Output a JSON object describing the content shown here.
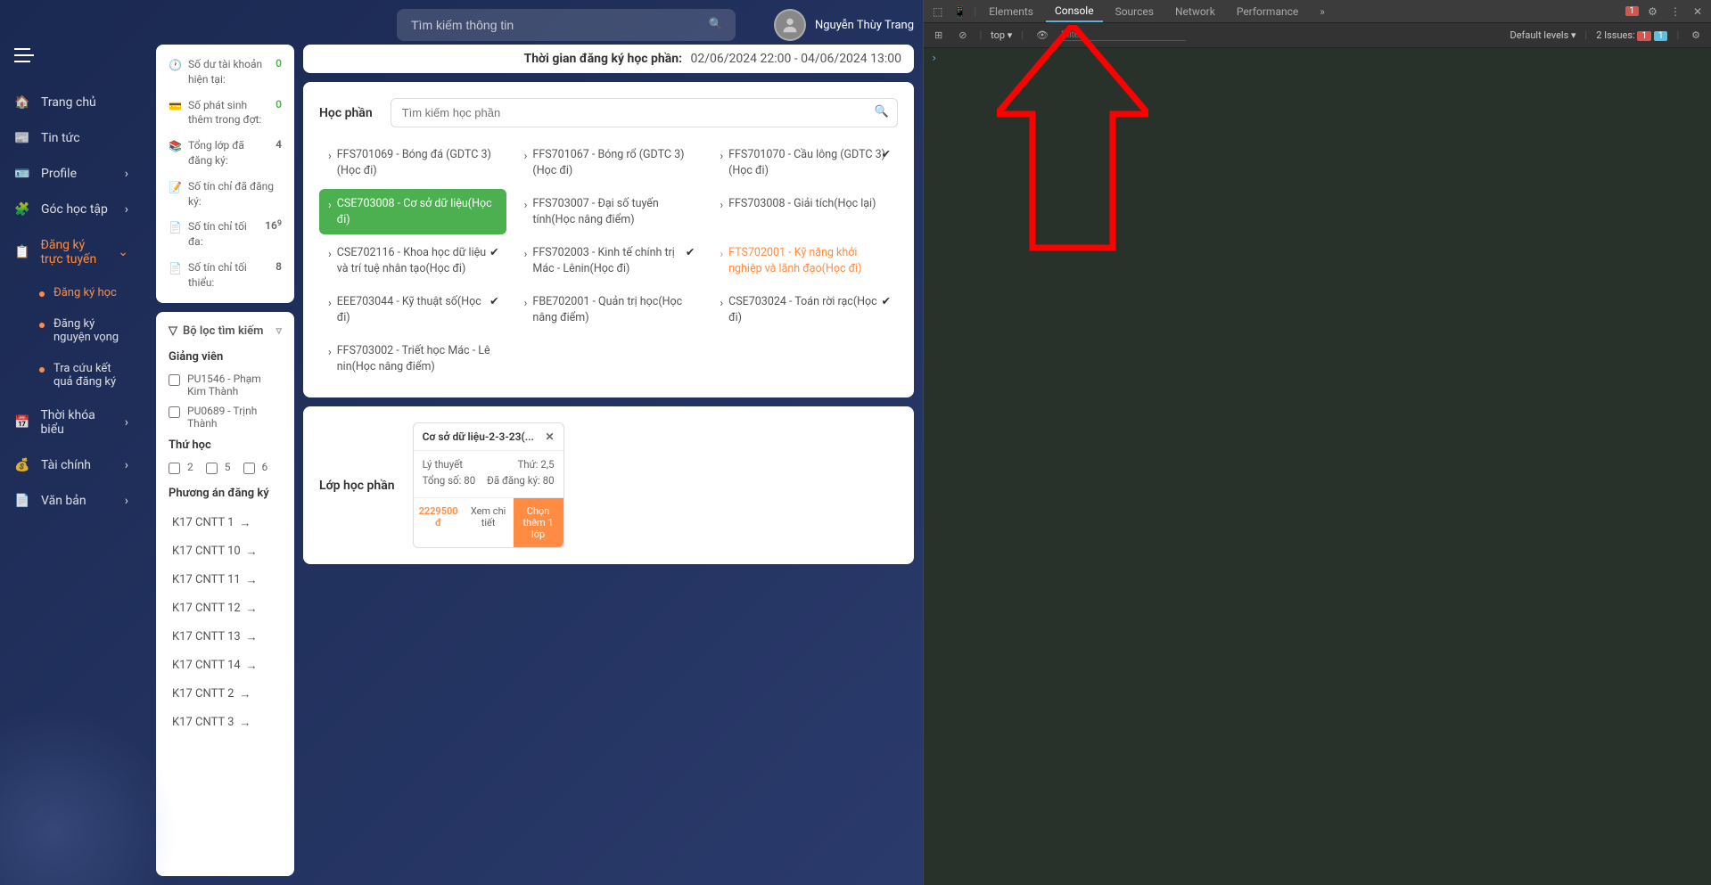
{
  "global_search_placeholder": "Tìm kiếm thông tin",
  "user_name": "Nguyễn Thùy Trang",
  "nav": {
    "home": "Trang chủ",
    "news": "Tin tức",
    "profile": "Profile",
    "study_corner": "Góc học tập",
    "register": "Đăng ký trực tuyến",
    "schedule": "Thời khóa biểu",
    "finance": "Tài chính",
    "documents": "Văn bản"
  },
  "subnav": {
    "reg_study": "Đăng ký học",
    "reg_wish": "Đăng ký nguyện vọng",
    "lookup": "Tra cứu kết quả đăng ký"
  },
  "stats": {
    "balance_label": "Số dư tài khoản hiện tại:",
    "balance_value": "0",
    "extra_label": "Số phát sinh thêm trong đợt:",
    "extra_value": "0",
    "total_class_label": "Tổng lớp đã đăng ký:",
    "total_class_value": "4",
    "credits_reg_label": "Số tín chỉ đã đăng ký:",
    "credits_reg_value": "",
    "credits_max_label": "Số tín chỉ tối đa:",
    "credits_max_value": "16",
    "credits_max_sup": "9",
    "credits_min_label": "Số tín chỉ tối thiểu:",
    "credits_min_value": "8"
  },
  "filter_title": "Bộ lọc tìm kiếm",
  "lecturer_label": "Giảng viên",
  "lecturers": [
    "PU1546 - Phạm Kim Thành",
    "PU0689 - Trịnh Thành"
  ],
  "day_label": "Thứ học",
  "days": [
    "2",
    "5",
    "6"
  ],
  "plan_label": "Phương án đăng ký",
  "plans": [
    "K17 CNTT 1",
    "K17 CNTT 10",
    "K17 CNTT 11",
    "K17 CNTT 12",
    "K17 CNTT 13",
    "K17 CNTT 14",
    "K17 CNTT 2",
    "K17 CNTT 3"
  ],
  "banner_label": "Thời gian đăng ký học phần:",
  "banner_time": "02/06/2024 22:00 - 04/06/2024 13:00",
  "course_section_title": "Học phần",
  "course_search_placeholder": "Tìm kiếm học phần",
  "courses": [
    {
      "name": "FFS701069 - Bóng đá (GDTC 3)(Học đi)",
      "checked": false,
      "state": "normal"
    },
    {
      "name": "FFS701067 - Bóng rổ (GDTC 3)(Học đi)",
      "checked": false,
      "state": "normal"
    },
    {
      "name": "FFS701070 - Cầu lông (GDTC 3)(Học đi)",
      "checked": true,
      "state": "normal"
    },
    {
      "name": "CSE703008 - Cơ sở dữ liệu(Học đi)",
      "checked": false,
      "state": "selected"
    },
    {
      "name": "FFS703007 - Đại số tuyến tính(Học nâng điểm)",
      "checked": false,
      "state": "normal"
    },
    {
      "name": "FFS703008 - Giải tích(Học lại)",
      "checked": false,
      "state": "normal"
    },
    {
      "name": "CSE702116 - Khoa học dữ liệu và trí tuệ nhân tạo(Học đi)",
      "checked": true,
      "state": "normal"
    },
    {
      "name": "FFS702003 - Kinh tế chính trị Mác - Lênin(Học đi)",
      "checked": true,
      "state": "normal"
    },
    {
      "name": "FTS702001 - Kỹ năng khởi nghiệp và lãnh đạo(Học đi)",
      "checked": false,
      "state": "disabled"
    },
    {
      "name": "EEE703044 - Kỹ thuật số(Học đi)",
      "checked": true,
      "state": "normal"
    },
    {
      "name": "FBE702001 - Quản trị học(Học nâng điểm)",
      "checked": false,
      "state": "normal"
    },
    {
      "name": "CSE703024 - Toán rời rạc(Học đi)",
      "checked": true,
      "state": "normal"
    },
    {
      "name": "FFS703002 - Triết học Mác - Lê nin(Học nâng điểm)",
      "checked": false,
      "state": "normal"
    }
  ],
  "class_section_title": "Lớp học phần",
  "class_box": {
    "title": "Cơ sở dữ liệu-2-3-23(...",
    "type_label": "Lý thuyết",
    "day_label": "Thứ: 2,5",
    "total_label": "Tổng số: 80",
    "registered_label": "Đã đăng ký: 80",
    "price": "2229500 đ",
    "detail_btn": "Xem chi tiết",
    "choose_btn": "Chọn thêm 1 lớp"
  },
  "devtools": {
    "tabs": [
      "Elements",
      "Console",
      "Sources",
      "Network",
      "Performance"
    ],
    "err_badge": "1",
    "context": "top",
    "filter_placeholder": "Filter",
    "levels": "Default levels",
    "issues_label": "2 Issues:",
    "issue_err": "1",
    "issue_info": "1"
  }
}
